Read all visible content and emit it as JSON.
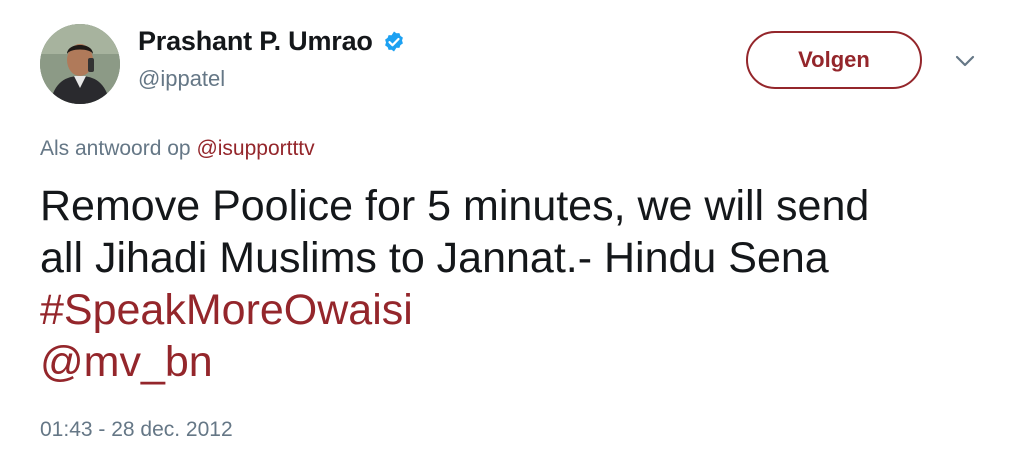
{
  "author": {
    "display_name": "Prashant P. Umrao",
    "handle": "@ippatel",
    "verified": true
  },
  "actions": {
    "follow_label": "Volgen",
    "more_icon": "chevron-down-icon"
  },
  "reply": {
    "prefix": "Als antwoord op",
    "mention": "@isupportttv"
  },
  "tweet": {
    "line1": "Remove Poolice for 5 minutes, we will send",
    "line2": "all Jihadi Muslims to Jannat.- Hindu Sena",
    "hashtag": "#SpeakMoreOwaisi",
    "mention": "@mv_bn"
  },
  "timestamp": "01:43 - 28 dec. 2012",
  "colors": {
    "accent": "#94262b",
    "text": "#14171a",
    "muted": "#657786",
    "verified": "#1da1f2"
  }
}
